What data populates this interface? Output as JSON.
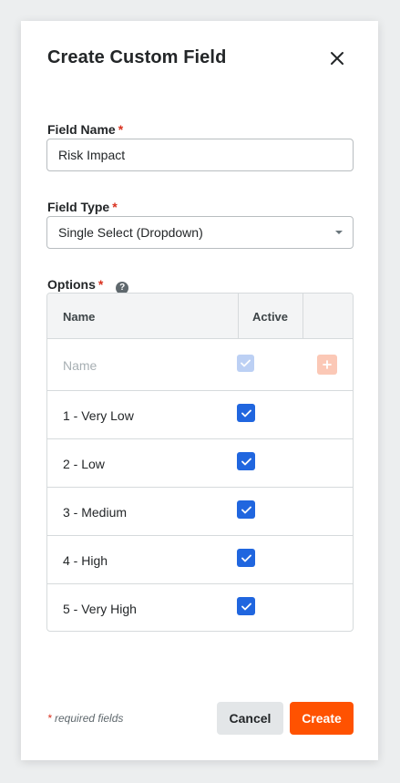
{
  "modal": {
    "title": "Create Custom Field"
  },
  "field_name": {
    "label": "Field Name",
    "required_marker": "*",
    "value": "Risk Impact"
  },
  "field_type": {
    "label": "Field Type",
    "required_marker": "*",
    "value": "Single Select (Dropdown)"
  },
  "options": {
    "label": "Options",
    "required_marker": "*",
    "help_icon": "question-circle-icon",
    "table": {
      "headers": {
        "name": "Name",
        "active": "Active"
      },
      "new_row": {
        "placeholder": "Name",
        "active": true,
        "add_icon": "plus-icon"
      },
      "rows": [
        {
          "label": "1 - Very Low",
          "active": true
        },
        {
          "label": "2 - Low",
          "active": true
        },
        {
          "label": "3 - Medium",
          "active": true
        },
        {
          "label": "4 - High",
          "active": true
        },
        {
          "label": "5 - Very High",
          "active": true
        }
      ]
    }
  },
  "footer": {
    "required_note_star": "*",
    "required_note": "required fields",
    "cancel_label": "Cancel",
    "create_label": "Create"
  },
  "colors": {
    "primary_action": "#ff5201",
    "checkbox": "#2066df",
    "required": "#d9311f"
  }
}
